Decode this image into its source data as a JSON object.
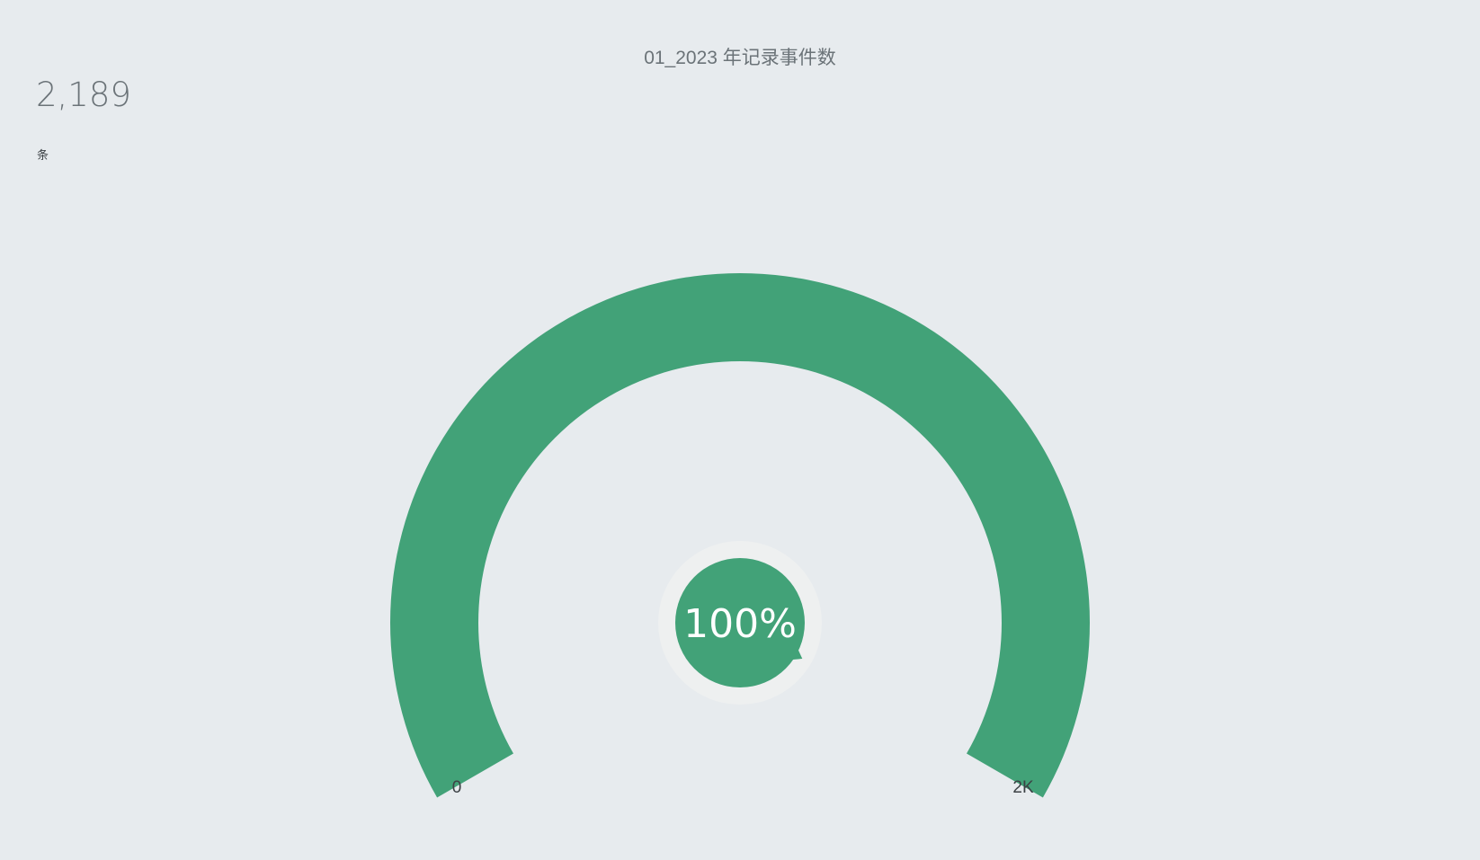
{
  "chart_data": {
    "type": "gauge",
    "title": "01_2023 年记录事件数",
    "value": 2189,
    "value_display": "2,189",
    "unit": "条",
    "min": 0,
    "max": 2000,
    "min_label": "0",
    "max_label": "2K",
    "percent_label": "100%",
    "start_angle_deg": 210,
    "end_angle_deg": -30
  },
  "colors": {
    "background": "#e7ebee",
    "gauge_fill": "#42a278",
    "gauge_track": "#dfe3e6",
    "hub_ring": "#eef0f0",
    "text_muted": "#6b7378",
    "text_dark": "#3c4145"
  }
}
